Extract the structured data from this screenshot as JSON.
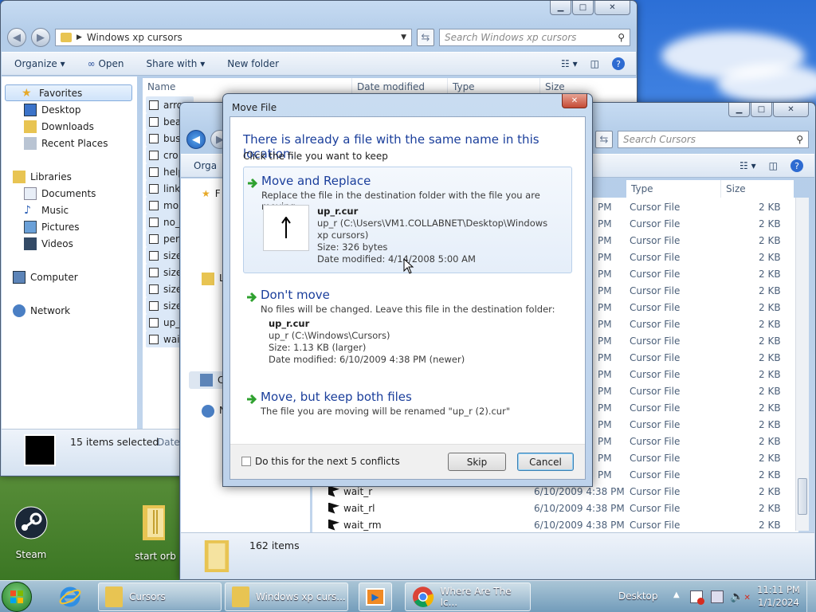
{
  "desktop": {
    "icons": [
      {
        "label": "Steam",
        "icon": "steam-icon"
      },
      {
        "label": "start orb",
        "icon": "folder-icon"
      }
    ]
  },
  "win1": {
    "address": "Windows xp cursors",
    "search_placeholder": "Search Windows xp cursors",
    "toolbar": {
      "organize": "Organize",
      "open": "Open",
      "share": "Share with",
      "newfolder": "New folder"
    },
    "nav": [
      {
        "label": "Favorites",
        "icon": "star-icon"
      },
      {
        "label": "Desktop",
        "icon": "desktop-icon"
      },
      {
        "label": "Downloads",
        "icon": "downloads-icon"
      },
      {
        "label": "Recent Places",
        "icon": "recent-icon"
      },
      {
        "label": "Libraries",
        "icon": "libraries-icon"
      },
      {
        "label": "Documents",
        "icon": "documents-icon"
      },
      {
        "label": "Music",
        "icon": "music-icon"
      },
      {
        "label": "Pictures",
        "icon": "pictures-icon"
      },
      {
        "label": "Videos",
        "icon": "videos-icon"
      },
      {
        "label": "Computer",
        "icon": "computer-icon"
      },
      {
        "label": "Network",
        "icon": "network-icon"
      }
    ],
    "columns": {
      "name": "Name",
      "date": "Date modified",
      "type": "Type",
      "size": "Size"
    },
    "files": [
      "arro",
      "bea",
      "bus",
      "cro",
      "help",
      "link",
      "mo",
      "no_",
      "per",
      "size",
      "size",
      "size",
      "size",
      "up_",
      "wai"
    ],
    "status": {
      "text": "15 items selected",
      "extra": "Date"
    }
  },
  "win2": {
    "search_placeholder": "Search Cursors",
    "toolbar": {
      "organize": "Orga"
    },
    "nav": [
      {
        "label": "F"
      },
      {
        "label": "L"
      },
      {
        "label": "C"
      },
      {
        "label": "N"
      }
    ],
    "columns": {
      "type": "Type",
      "size": "Size"
    },
    "rows_partial": {
      "time": "PM",
      "type": "Cursor File",
      "size": "2 KB",
      "count": 17
    },
    "rows_full": [
      {
        "name": "wait_r",
        "date": "6/10/2009 4:38 PM",
        "type": "Cursor File",
        "size": "2 KB"
      },
      {
        "name": "wait_rl",
        "date": "6/10/2009 4:38 PM",
        "type": "Cursor File",
        "size": "2 KB"
      },
      {
        "name": "wait_rm",
        "date": "6/10/2009 4:38 PM",
        "type": "Cursor File",
        "size": "2 KB"
      }
    ],
    "status": {
      "text": "162 items"
    }
  },
  "dialog": {
    "title": "Move File",
    "heading": "There is already a file with the same name in this location.",
    "sub": "Click the file you want to keep",
    "opt1": {
      "title": "Move and Replace",
      "desc": "Replace the file in the destination folder with the file you are moving:",
      "file": "up_r.cur",
      "path": "up_r (C:\\Users\\VM1.COLLABNET\\Desktop\\Windows xp cursors)",
      "size": "Size: 326 bytes",
      "date": "Date modified: 4/14/2008 5:00 AM"
    },
    "opt2": {
      "title": "Don't move",
      "desc": "No files will be changed. Leave this file in the destination folder:",
      "file": "up_r.cur",
      "path": "up_r (C:\\Windows\\Cursors)",
      "size": "Size: 1.13 KB (larger)",
      "date": "Date modified: 6/10/2009 4:38 PM (newer)"
    },
    "opt3": {
      "title": "Move, but keep both files",
      "desc": "The file you are moving will be renamed \"up_r (2).cur\""
    },
    "checkbox": "Do this for the next 5 conflicts",
    "skip": "Skip",
    "cancel": "Cancel"
  },
  "taskbar": {
    "items": [
      {
        "label": "Cursors"
      },
      {
        "label": "Windows xp curs..."
      },
      {
        "label": ""
      },
      {
        "label": "Where Are The Ic..."
      }
    ],
    "desktop": "Desktop",
    "time": "11:11 PM",
    "date": "1/1/2024"
  }
}
